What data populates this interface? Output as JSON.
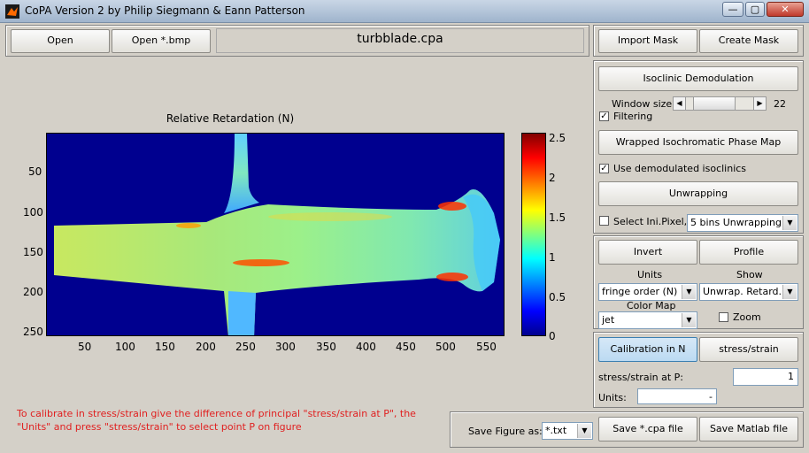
{
  "window": {
    "title": "CoPA Version 2 by Philip Siegmann & Eann Patterson",
    "min": "—",
    "max": "▢",
    "close": "✕"
  },
  "top": {
    "open": "Open",
    "open_bmp": "Open *.bmp",
    "filename": "turbblade.cpa",
    "import_mask": "Import Mask",
    "create_mask": "Create Mask"
  },
  "plot": {
    "title": "Relative Retardation (N)",
    "x_ticks": [
      "50",
      "100",
      "150",
      "200",
      "250",
      "300",
      "350",
      "400",
      "450",
      "500",
      "550"
    ],
    "y_ticks": [
      "50",
      "100",
      "150",
      "200",
      "250"
    ],
    "colorbar_ticks": [
      "2.5",
      "2",
      "1.5",
      "1",
      "0.5",
      "0"
    ],
    "colors": {
      "background": "#00008f",
      "blade": "#c8e860",
      "hot": "#ff4000",
      "cyan": "#20c0ff"
    }
  },
  "panel1": {
    "isoclinic_btn": "Isoclinic Demodulation",
    "window_size_label": "Window size:",
    "window_size_value": "22",
    "window_size_fraction": 0.55,
    "filtering": "Filtering",
    "wrapped_btn": "Wrapped Isochromatic Phase Map",
    "use_demod": "Use demodulated isoclinics",
    "unwrapping_btn": "Unwrapping",
    "select_pixel": "Select Ini.Pixel,",
    "bins_value": "5 bins Unwrapping"
  },
  "panel2": {
    "invert_btn": "Invert",
    "profile_btn": "Profile",
    "units_label": "Units",
    "show_label": "Show",
    "units_value": "fringe order (N)",
    "show_value": "Unwrap. Retard.",
    "colormap_label": "Color Map",
    "colormap_value": "jet",
    "zoom": "Zoom"
  },
  "panel3": {
    "calibration_btn": "Calibration in N",
    "stress_btn": "stress/strain",
    "stress_at_p_label": "stress/strain at P:",
    "stress_at_p_value": "1",
    "units_label": "Units:",
    "units_value": "-"
  },
  "bottom": {
    "message": "To calibrate in stress/strain give the difference of principal \"stress/strain at P\", the \"Units\" and press \"stress/strain\" to select point P on figure",
    "save_figure_label": "Save Figure as:",
    "save_figure_value": "*.txt",
    "save_cpa": "Save *.cpa file",
    "save_matlab": "Save Matlab file"
  }
}
